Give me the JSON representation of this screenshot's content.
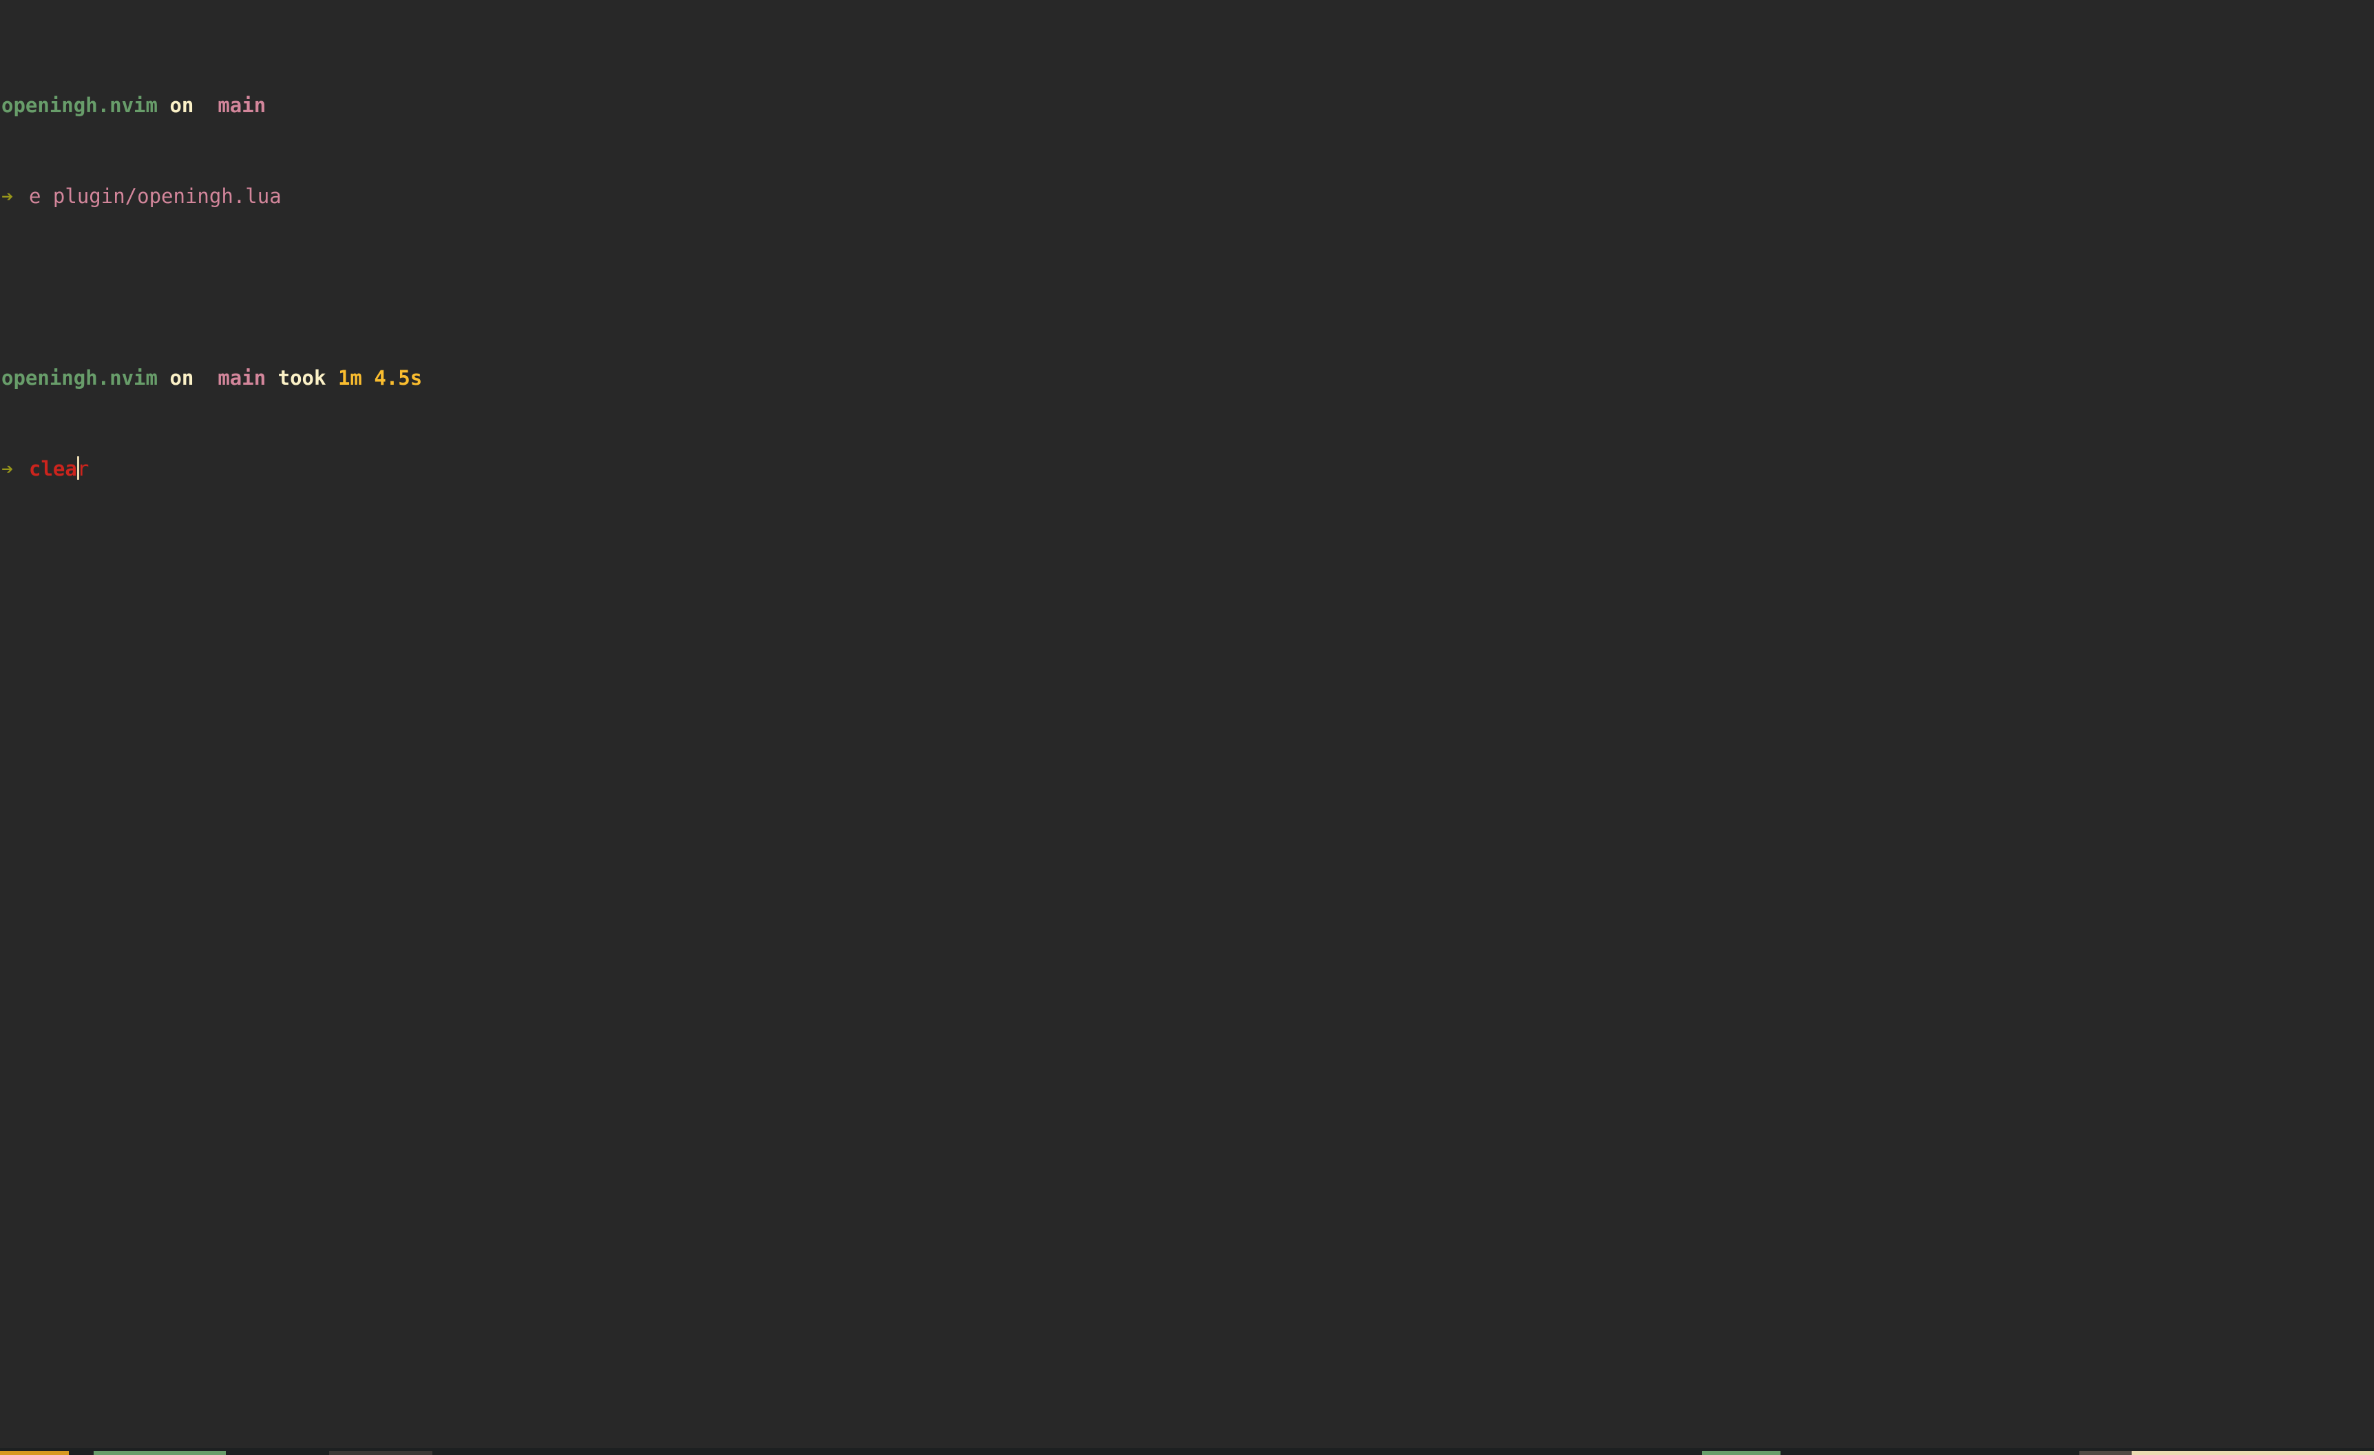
{
  "prompt1": {
    "directory": "openingh.nvim",
    "on": "on",
    "branch_icon": "",
    "branch": "main",
    "arrow": "➔",
    "command": "e plugin/openingh.lua"
  },
  "prompt2": {
    "directory": "openingh.nvim",
    "on": "on",
    "branch_icon": "",
    "branch": "main",
    "took": "took",
    "duration": "1m 4.5s",
    "arrow": "➔",
    "command_typed": "clea",
    "command_suggestion": "r"
  },
  "colors": {
    "background": "#282828",
    "directory": "#689d6a",
    "branch": "#d3869b",
    "duration": "#fabd2f",
    "arrow": "#98971a",
    "command_error": "#cc241d"
  }
}
